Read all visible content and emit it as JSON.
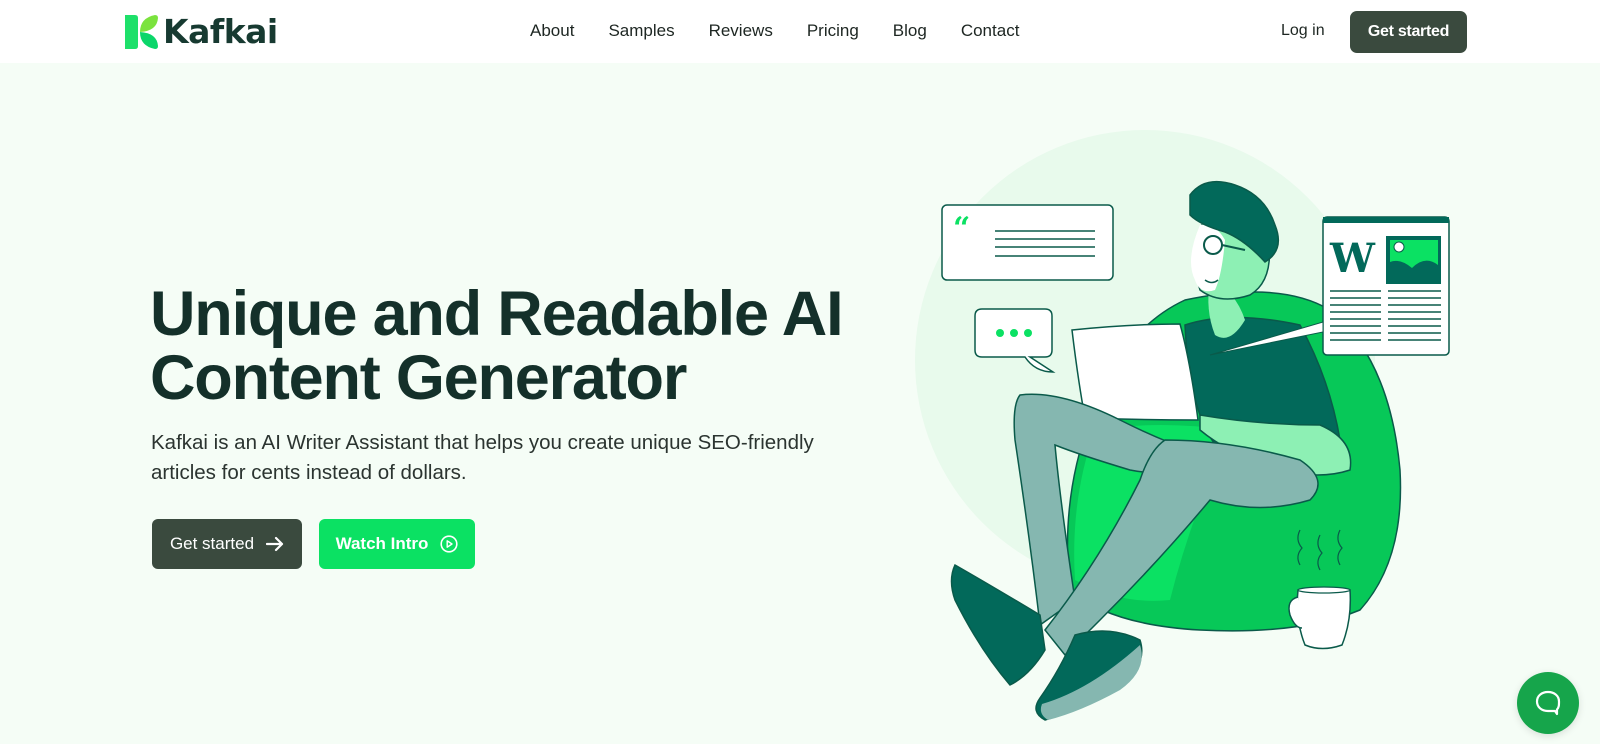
{
  "header": {
    "logo_text": "Kafkai",
    "nav": [
      {
        "label": "About"
      },
      {
        "label": "Samples"
      },
      {
        "label": "Reviews"
      },
      {
        "label": "Pricing"
      },
      {
        "label": "Blog"
      },
      {
        "label": "Contact"
      }
    ],
    "login_label": "Log in",
    "cta_label": "Get started"
  },
  "hero": {
    "title_line1": "Unique and Readable AI",
    "title_line2": "Content Generator",
    "subtitle": "Kafkai is an AI Writer Assistant that helps you create unique SEO-friendly articles for cents instead of dollars.",
    "primary_button": {
      "label": "Get started",
      "icon": "arrow-right-icon"
    },
    "secondary_button": {
      "label": "Watch Intro",
      "icon": "play-circle-icon"
    }
  },
  "illustration": {
    "description": "Person sitting on green bean bag with laptop, quote card, typing bubble, article card, coffee mug",
    "article_letter": "W"
  },
  "chat_widget": {
    "icon": "chat-bubble-icon"
  },
  "colors": {
    "brand_green": "#0be163",
    "dark_button": "#3a4a3e",
    "dark_teal": "#02695a",
    "heading": "#14302a",
    "page_bg": "#f5fdf6",
    "chat_fab": "#16a54b"
  }
}
